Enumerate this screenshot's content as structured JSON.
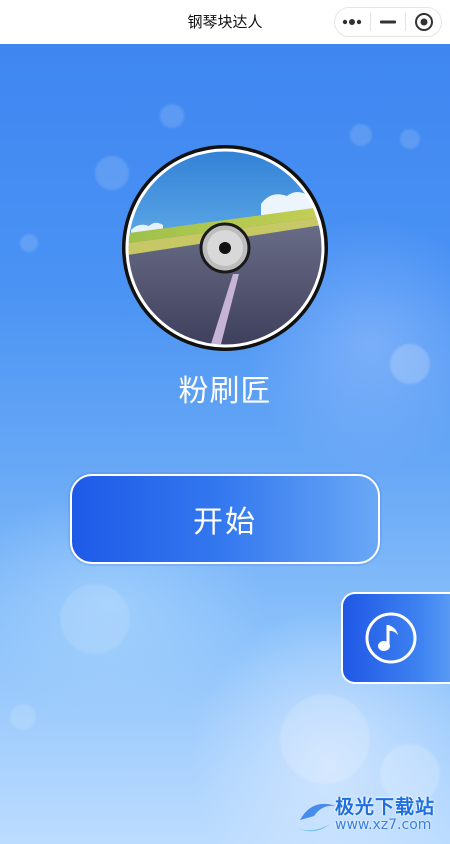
{
  "header": {
    "title": "钢琴块达人",
    "capsule": {
      "more_icon": "more-dots-icon",
      "minimize_icon": "minimize-icon",
      "close_icon": "target-circle-icon"
    }
  },
  "main": {
    "song_title": "粉刷匠",
    "start_label": "开始",
    "music_icon": "music-note-icon",
    "accent_color": "#2563eb"
  },
  "watermark": {
    "brand": "极光下载站",
    "url": "www.xz7.com"
  }
}
